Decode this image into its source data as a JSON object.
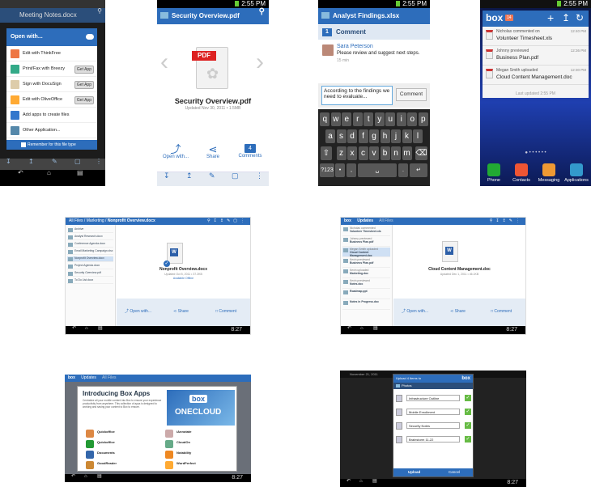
{
  "p1": {
    "title": "Meeting Notes.docx",
    "dialog_title": "Open with...",
    "items": [
      {
        "label": "Edit with ThinkFree",
        "action": "",
        "color": "#e74"
      },
      {
        "label": "Print/Fax with Breezy",
        "action": "Get App",
        "color": "#3a8"
      },
      {
        "label": "Sign with DocuSign",
        "action": "Get App",
        "color": "#dca"
      },
      {
        "label": "Edit with OliveOffice",
        "action": "Get App",
        "color": "#fa3"
      },
      {
        "label": "Add apps to create files",
        "action": "",
        "color": "#37c"
      },
      {
        "label": "Other Application...",
        "action": "",
        "color": "#58a"
      }
    ],
    "remember": "Remember for this file type"
  },
  "p2": {
    "time": "2:55 PM",
    "title": "Security Overview.pdf",
    "pdf_badge": "PDF",
    "file_name": "Security Overview.pdf",
    "meta": "Updated Nov 30, 2011 • 1.5MB",
    "open": "Open with...",
    "share": "Share",
    "comments": "Comments",
    "comment_count": "4"
  },
  "p3": {
    "time": "2:55 PM",
    "title": "Analyst Findings.xlsx",
    "header": "Comment",
    "header_count": "1",
    "author": "Sara Peterson",
    "text": "Please review and suggest next steps.",
    "ago": "15 min",
    "input": "According to the findings we need to evaluate...",
    "button": "Comment",
    "row1": [
      "q",
      "w",
      "e",
      "r",
      "t",
      "y",
      "u",
      "i",
      "o",
      "p"
    ],
    "row2": [
      "a",
      "s",
      "d",
      "f",
      "g",
      "h",
      "j",
      "k",
      "l"
    ],
    "row3": [
      "z",
      "x",
      "c",
      "v",
      "b",
      "n",
      "m"
    ],
    "special": {
      "symbols": "?123",
      "comma": ",",
      "period": "."
    }
  },
  "p4": {
    "time": "2:55 PM",
    "logo": "box",
    "badge": "14",
    "notifs": [
      {
        "line1": "Nicholas commented on",
        "line2": "Volunteer Timesheet.xls",
        "time": "12:40 PM"
      },
      {
        "line1": "Johnny previewed",
        "line2": "Business Plan.pdf",
        "time": "12:36 PM"
      },
      {
        "line1": "Megan Smith uploaded",
        "line2": "Cloud Content Management.doc",
        "time": "12:30 PM"
      }
    ],
    "updated": "Last updated 2:55 PM",
    "dock": [
      {
        "label": "Phone",
        "color": "#2a3"
      },
      {
        "label": "Contacts",
        "color": "#e53"
      },
      {
        "label": "Messaging",
        "color": "#e93"
      },
      {
        "label": "Applications",
        "color": "#39c"
      }
    ]
  },
  "p5": {
    "breadcrumb": [
      "All Files",
      "Marketing",
      "Nonprofit Overview.docx"
    ],
    "files": [
      "Archive",
      "Analyst Research.docx",
      "Conference Agenda.docx",
      "Email Marketing Campaign.xlsx",
      "Nonprofit Overview.docx",
      "Project Agenda.docx",
      "Security Overview.pdf",
      "To Do List.docx"
    ],
    "file_name": "Nonprofit Overview.docx",
    "meta": "Updated Oct 5, 2011 • 37.2KB",
    "office": "Available Offline",
    "open": "Open with...",
    "share": "Share",
    "comment": "Comment",
    "time": "8:27"
  },
  "p6": {
    "logo": "box",
    "tabs": [
      "Updates",
      "All Files"
    ],
    "updates": [
      {
        "who": "Nicholas commented",
        "file": "Volunteer Timesheet.xls"
      },
      {
        "who": "Johnny previewed",
        "file": "Business Plan.pdf"
      },
      {
        "who": "Megan Smith uploaded",
        "file": "Cloud Content Management.doc"
      },
      {
        "who": "Kevin previewed",
        "file": "Business Plan.pdf"
      },
      {
        "who": "Kevin uploaded",
        "file": "Marketing.doc"
      },
      {
        "who": "Kevin previewed",
        "file": "Notes.doc"
      },
      {
        "who": "",
        "file": "Roadmap.ppt"
      },
      {
        "who": "",
        "file": "Notes in Progress.doc"
      }
    ],
    "file_name": "Cloud Content Management.doc",
    "meta": "Updated Dec 1, 2011 • 46.1KB",
    "open": "Open with...",
    "share": "Share",
    "comment": "Comment",
    "time": "8:27"
  },
  "p7": {
    "logo": "box",
    "tabs": [
      "Updates",
      "All Files"
    ],
    "title": "Introducing Box Apps",
    "body": "Centralize all your mobile content into Box to ensure your experience productivity from anywhere. This collection of apps is designed to working and saving your content to Box to ensure.",
    "hero1": "box",
    "hero2": "ONECLOUD",
    "apps": [
      {
        "name": "Quickoffice",
        "color": "#d84"
      },
      {
        "name": "iAnnotate",
        "color": "#caa"
      },
      {
        "name": "Quickoffice",
        "color": "#293"
      },
      {
        "name": "CloudOn",
        "color": "#6a8"
      },
      {
        "name": "Documents",
        "color": "#36a"
      },
      {
        "name": "Notability",
        "color": "#e82"
      },
      {
        "name": "GoodReader",
        "color": "#c83"
      },
      {
        "name": "WordPerfect",
        "color": "#fa3"
      }
    ],
    "time": "8:27"
  },
  "p8": {
    "date": "November 21, 2011",
    "header": "Upload 4 items to",
    "logo": "box",
    "folder": "Photos",
    "items": [
      "Infrastructure Outline",
      "Mobile Enrollment",
      "Security Notes",
      "Brainstorm 11-22"
    ],
    "upload": "Upload",
    "cancel": "Cancel",
    "time": "8:27"
  }
}
